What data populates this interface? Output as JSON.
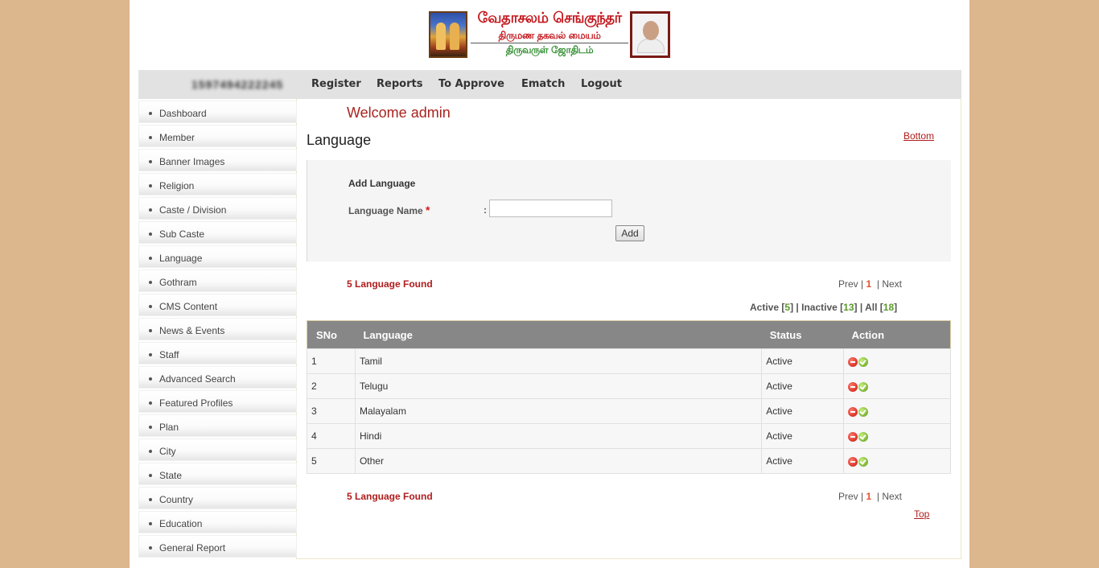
{
  "header": {
    "logo_line1": "வேதாசலம் செங்குந்தர்",
    "logo_line2": "திருமண தகவல் மையம்",
    "logo_line3": "திருவருள் ஜோதிடம்"
  },
  "topnav": {
    "phone": "1597494222245",
    "links": [
      "Register",
      "Reports",
      "To Approve",
      "Ematch",
      "Logout"
    ]
  },
  "sidebar": {
    "items": [
      "Dashboard",
      "Member",
      "Banner Images",
      "Religion",
      "Caste / Division",
      "Sub Caste",
      "Language",
      "Gothram",
      "CMS Content",
      "News & Events",
      "Staff",
      "Advanced Search",
      "Featured Profiles",
      "Plan",
      "City",
      "State",
      "Country",
      "Education",
      "General Report"
    ]
  },
  "main": {
    "welcome": "Welcome admin",
    "title": "Language",
    "bottom_link": "Bottom",
    "top_link": "Top",
    "form": {
      "heading": "Add Language",
      "field_label": "Language Name",
      "required_mark": "*",
      "colon": ":",
      "field_value": "",
      "add_button": "Add"
    },
    "found_text": "5 Language Found",
    "pager": {
      "prev": "Prev",
      "sep": "|",
      "current": "1",
      "next": "Next"
    },
    "filters": {
      "active_label": "Active",
      "active_count": "5",
      "inactive_label": "Inactive",
      "inactive_count": "13",
      "all_label": "All",
      "all_count": "18"
    },
    "table": {
      "columns": [
        "SNo",
        "Language",
        "Status",
        "Action"
      ],
      "rows": [
        {
          "sno": "1",
          "language": "Tamil",
          "status": "Active"
        },
        {
          "sno": "2",
          "language": "Telugu",
          "status": "Active"
        },
        {
          "sno": "3",
          "language": "Malayalam",
          "status": "Active"
        },
        {
          "sno": "4",
          "language": "Hindi",
          "status": "Active"
        },
        {
          "sno": "5",
          "language": "Other",
          "status": "Active"
        }
      ],
      "action_icons": [
        "delete-icon",
        "activate-icon"
      ]
    }
  },
  "colors": {
    "page_bg": "#dcb68c",
    "accent_red": "#b01c1c",
    "table_header": "#878787",
    "count_green": "#5a9a2a"
  }
}
